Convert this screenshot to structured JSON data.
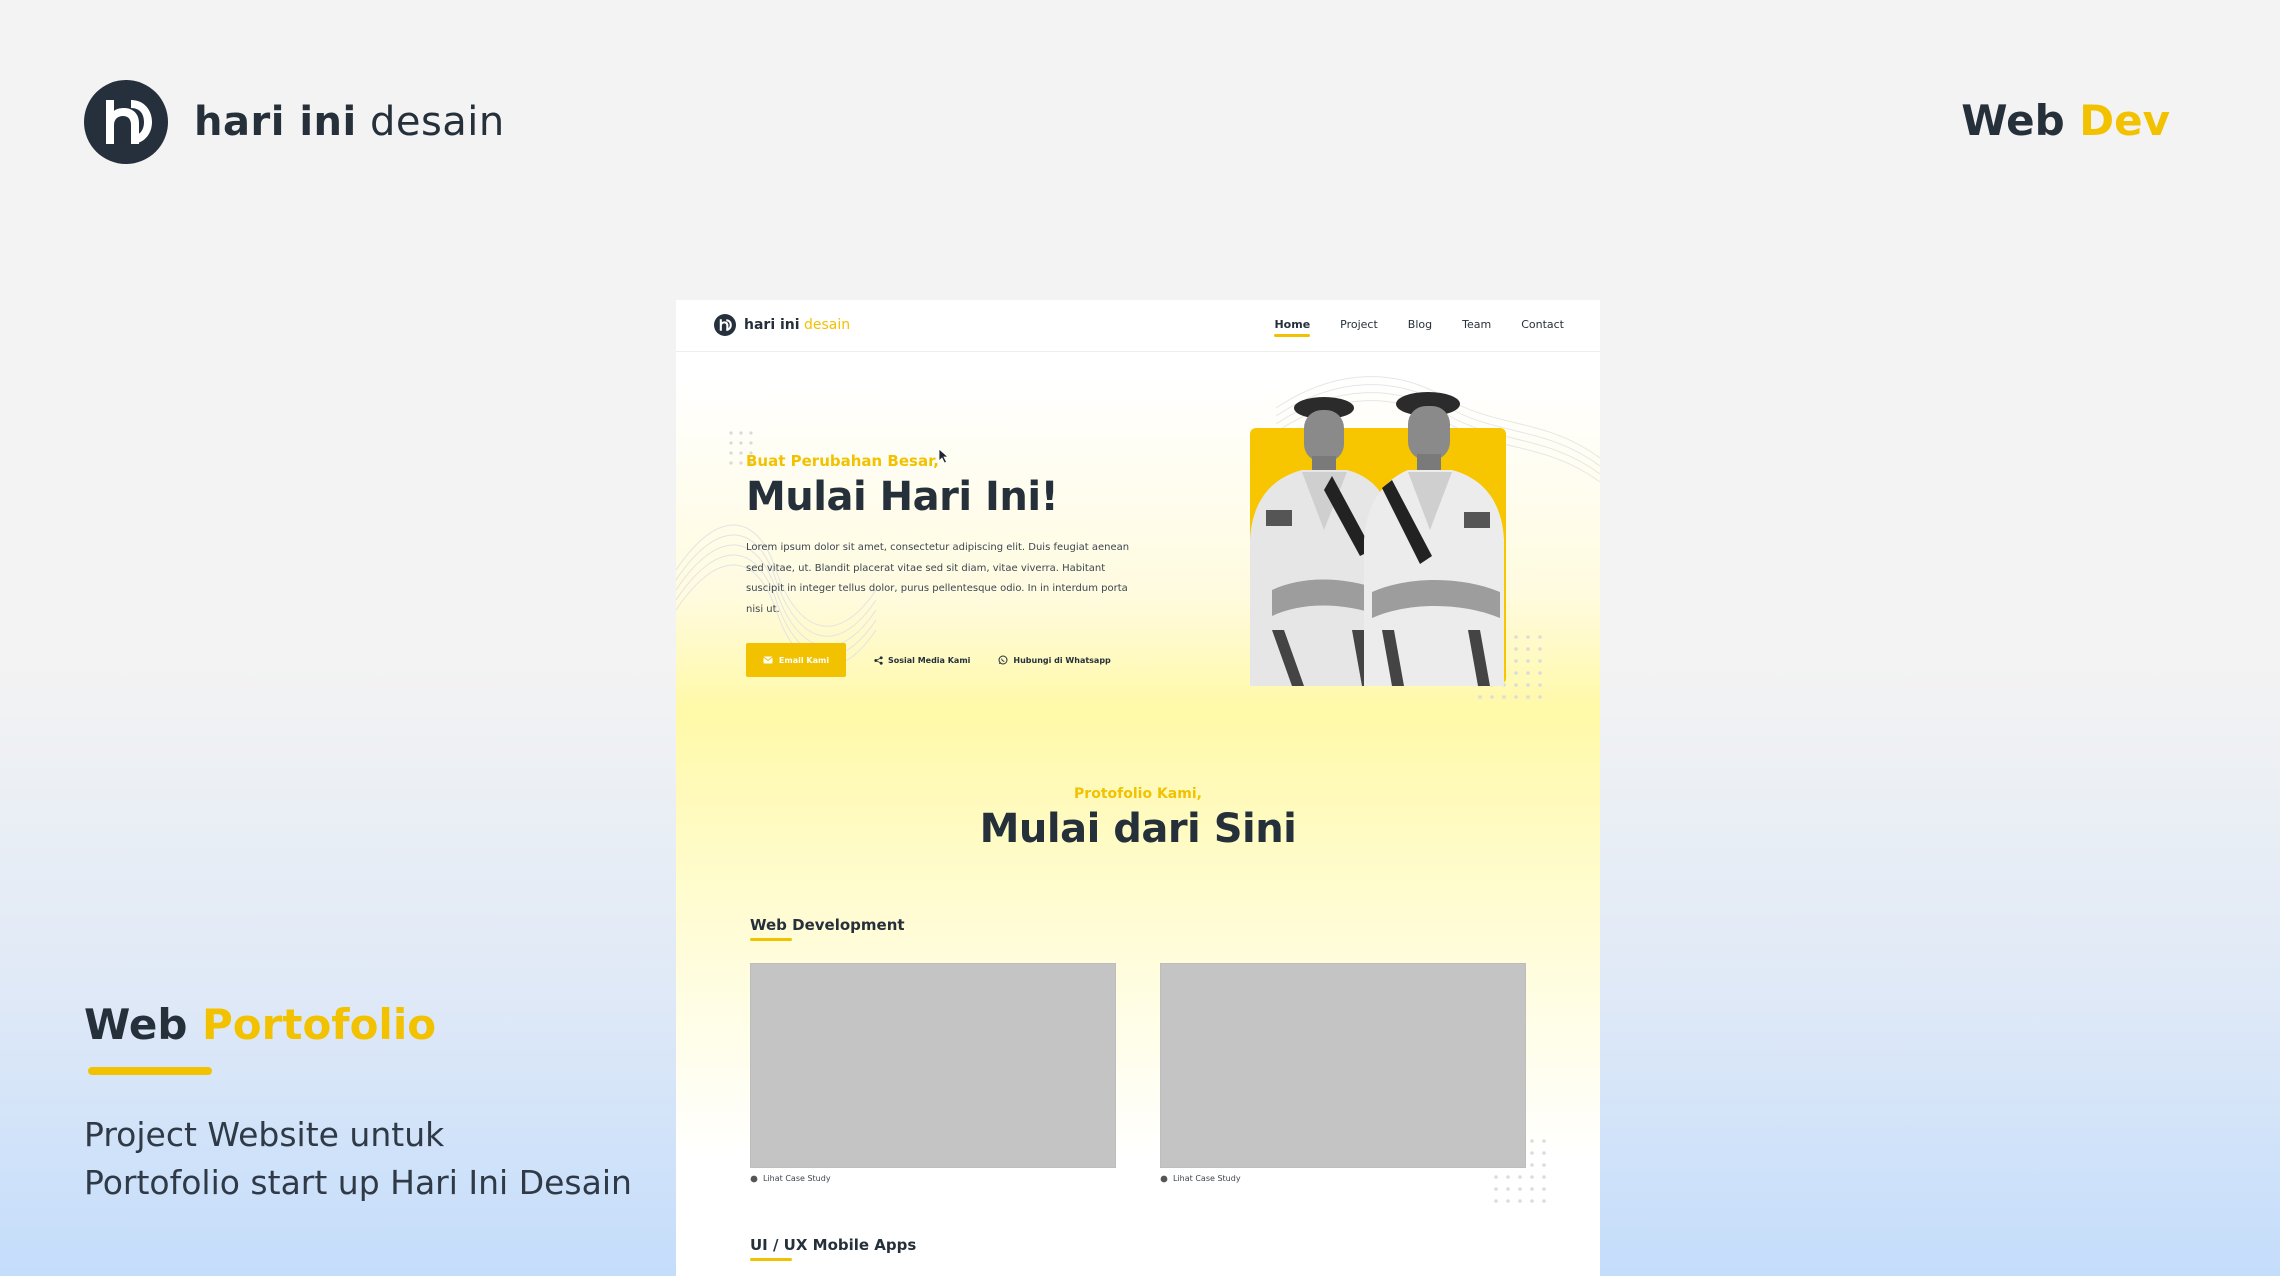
{
  "brand": {
    "name_bold": "hari ini",
    "name_light": "desain"
  },
  "tag": {
    "part1": "Web",
    "part2": "Dev"
  },
  "side": {
    "title_part1": "Web",
    "title_part2": "Portofolio",
    "desc_line1": "Project Website untuk",
    "desc_line2": "Portofolio start up Hari Ini Desain"
  },
  "mockup": {
    "logo": {
      "bold": "hari ini",
      "light": "desain"
    },
    "nav": [
      {
        "label": "Home",
        "active": true
      },
      {
        "label": "Project"
      },
      {
        "label": "Blog"
      },
      {
        "label": "Team"
      },
      {
        "label": "Contact"
      }
    ],
    "hero": {
      "kicker": "Buat Perubahan Besar,",
      "title": "Mulai Hari Ini!",
      "desc": "Lorem ipsum dolor sit amet, consectetur adipiscing elit. Duis feugiat aenean sed vitae, ut. Blandit placerat vitae sed sit diam, vitae viverra. Habitant suscipit in integer tellus dolor, purus pellentesque odio. In in interdum porta nisi ut.",
      "btn_email": "Email Kami",
      "link_social": "Sosial Media Kami",
      "link_whatsapp": "Hubungi di Whatsapp"
    },
    "portfolio": {
      "kicker": "Protofolio Kami,",
      "title": "Mulai dari Sini",
      "category1": "Web Development",
      "category2": "UI / UX Mobile Apps",
      "case_label": "Lihat Case Study"
    }
  },
  "colors": {
    "accent": "#f2c200",
    "dark": "#25303b",
    "placeholder": "#c4c4c4"
  }
}
